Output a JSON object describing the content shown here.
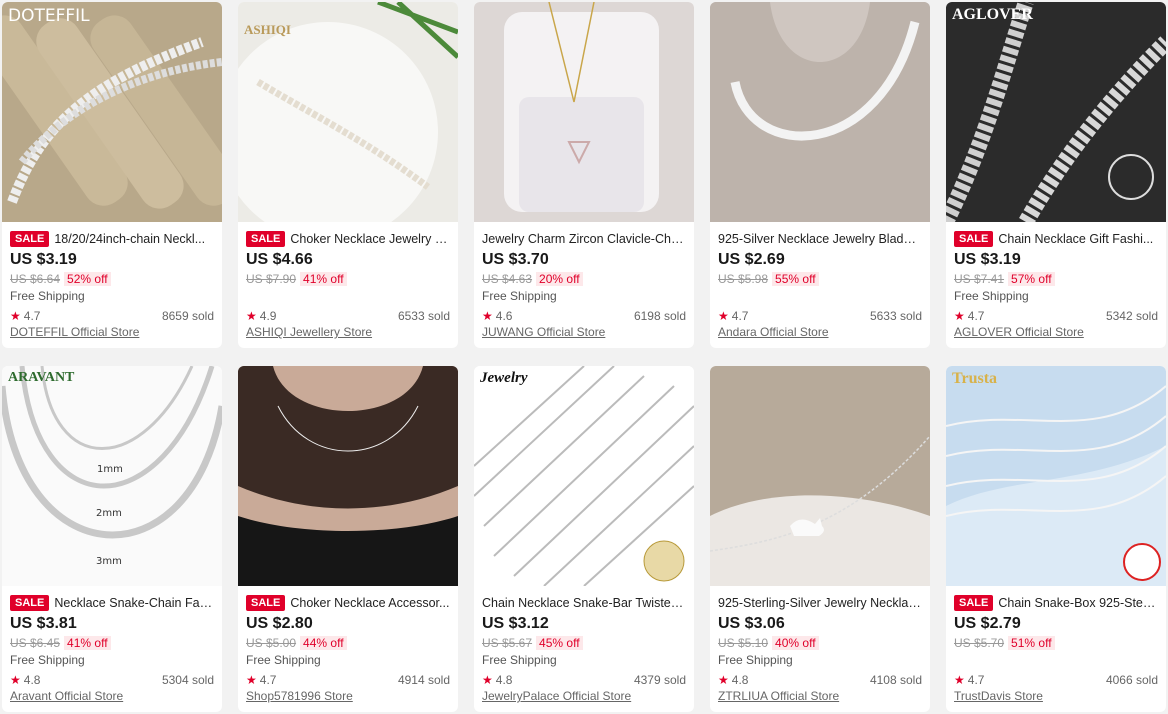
{
  "products": [
    {
      "brand": "DOTEFFIL",
      "sale": "SALE",
      "title": "18/20/24inch-chain Neckl...",
      "price": "US $3.19",
      "original_price": "US $6.64",
      "discount": "52% off",
      "shipping": "Free Shipping",
      "rating": "4.7",
      "sold": "8659 sold",
      "store": "DOTEFFIL Official Store"
    },
    {
      "brand": "ASHIQI",
      "sale": "SALE",
      "title": "Choker Necklace Jewelry C...",
      "price": "US $4.66",
      "original_price": "US $7.90",
      "discount": "41% off",
      "shipping": "",
      "rating": "4.9",
      "sold": "6533 sold",
      "store": "ASHIQI Jewellery Store"
    },
    {
      "brand": "",
      "sale": "",
      "title": "Jewelry Charm Zircon Clavicle-Chai...",
      "price": "US $3.70",
      "original_price": "US $4.63",
      "discount": "20% off",
      "shipping": "Free Shipping",
      "rating": "4.6",
      "sold": "6198 sold",
      "store": "JUWANG Official Store"
    },
    {
      "brand": "",
      "sale": "",
      "title": "925-Silver Necklace Jewelry Blade-...",
      "price": "US $2.69",
      "original_price": "US $5.98",
      "discount": "55% off",
      "shipping": "",
      "rating": "4.7",
      "sold": "5633 sold",
      "store": "Andara Official Store"
    },
    {
      "brand": "AGLOVER",
      "sale": "SALE",
      "title": "Chain Necklace Gift Fashi...",
      "price": "US $3.19",
      "original_price": "US $7.41",
      "discount": "57% off",
      "shipping": "Free Shipping",
      "rating": "4.7",
      "sold": "5342 sold",
      "store": "AGLOVER Official Store"
    },
    {
      "brand": "ARAVANT",
      "sale": "SALE",
      "title": "Necklace Snake-Chain Fas...",
      "price": "US $3.81",
      "original_price": "US $6.45",
      "discount": "41% off",
      "shipping": "Free Shipping",
      "rating": "4.8",
      "sold": "5304 sold",
      "store": "Aravant Official Store"
    },
    {
      "brand": "",
      "sale": "SALE",
      "title": "Choker Necklace Accessor...",
      "price": "US $2.80",
      "original_price": "US $5.00",
      "discount": "44% off",
      "shipping": "Free Shipping",
      "rating": "4.7",
      "sold": "4914 sold",
      "store": "Shop5781996 Store"
    },
    {
      "brand": "Jewelry",
      "sale": "",
      "title": "Chain Necklace Snake-Bar Twisted...",
      "price": "US $3.12",
      "original_price": "US $5.67",
      "discount": "45% off",
      "shipping": "Free Shipping",
      "rating": "4.8",
      "sold": "4379 sold",
      "store": "JewelryPalace Official Store"
    },
    {
      "brand": "",
      "sale": "",
      "title": "925-Sterling-Silver Jewelry Necklac...",
      "price": "US $3.06",
      "original_price": "US $5.10",
      "discount": "40% off",
      "shipping": "Free Shipping",
      "rating": "4.8",
      "sold": "4108 sold",
      "store": "ZTRLIUA Official Store"
    },
    {
      "brand": "Trusta",
      "sale": "SALE",
      "title": "Chain Snake-Box 925-Sterl...",
      "price": "US $2.79",
      "original_price": "US $5.70",
      "discount": "51% off",
      "shipping": "",
      "rating": "4.7",
      "sold": "4066 sold",
      "store": "TrustDavis Store"
    }
  ],
  "image_labels": {
    "mm1": "1mm",
    "mm2": "2mm",
    "mm3": "3mm"
  },
  "colors": {
    "sale": "#e0002a",
    "discount_bg": "#fde8ea",
    "page_bg": "#f2f2f2"
  }
}
